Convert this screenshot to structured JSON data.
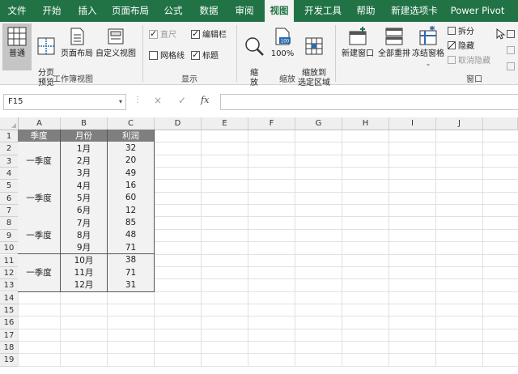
{
  "tabs": [
    "文件",
    "开始",
    "插入",
    "页面布局",
    "公式",
    "数据",
    "审阅",
    "视图",
    "开发工具",
    "帮助",
    "新建选项卡",
    "Power Pivot"
  ],
  "active_tab": "视图",
  "ribbon": {
    "workbook_views": {
      "label": "工作簿视图",
      "normal": "普通",
      "page_break": "分页\n预览",
      "page_layout": "页面布局",
      "custom_views": "自定义视图"
    },
    "show": {
      "label": "显示",
      "ruler": "直尺",
      "formula_bar": "编辑栏",
      "gridlines": "网格线",
      "headings": "标题"
    },
    "zoom": {
      "label": "缩放",
      "zoom": "缩\n放",
      "zoom_100": "100%",
      "zoom_selection": "缩放到\n选定区域"
    },
    "window": {
      "label": "窗口",
      "new_window": "新建窗口",
      "arrange_all": "全部重排",
      "freeze_panes": "冻结窗格",
      "split": "拆分",
      "hide": "隐藏",
      "unhide": "取消隐藏"
    }
  },
  "formula_bar": {
    "name_box": "F15",
    "fx": "fx",
    "cancel": "×",
    "enter": "✓",
    "value": ""
  },
  "columns": [
    "A",
    "B",
    "C",
    "D",
    "E",
    "F",
    "G",
    "H",
    "I",
    "J"
  ],
  "rows": [
    "1",
    "2",
    "3",
    "4",
    "5",
    "6",
    "7",
    "8",
    "9",
    "10",
    "11",
    "12",
    "13",
    "14",
    "15",
    "16",
    "17",
    "18",
    "19"
  ],
  "table": {
    "headers": [
      "季度",
      "月份",
      "利润"
    ],
    "groups": [
      {
        "quarter": "一季度",
        "rows": [
          [
            "1月",
            "32"
          ],
          [
            "2月",
            "20"
          ],
          [
            "3月",
            "49"
          ]
        ]
      },
      {
        "quarter": "一季度",
        "rows": [
          [
            "4月",
            "16"
          ],
          [
            "5月",
            "60"
          ],
          [
            "6月",
            "12"
          ]
        ]
      },
      {
        "quarter": "一季度",
        "rows": [
          [
            "7月",
            "85"
          ],
          [
            "8月",
            "48"
          ],
          [
            "9月",
            "71"
          ]
        ]
      },
      {
        "quarter": "一季度",
        "rows": [
          [
            "10月",
            "38"
          ],
          [
            "11月",
            "71"
          ],
          [
            "12月",
            "31"
          ]
        ]
      }
    ]
  },
  "colors": {
    "accent": "#217346",
    "header_fill": "#7f7f7f",
    "data_fill": "#f2f2f2"
  }
}
